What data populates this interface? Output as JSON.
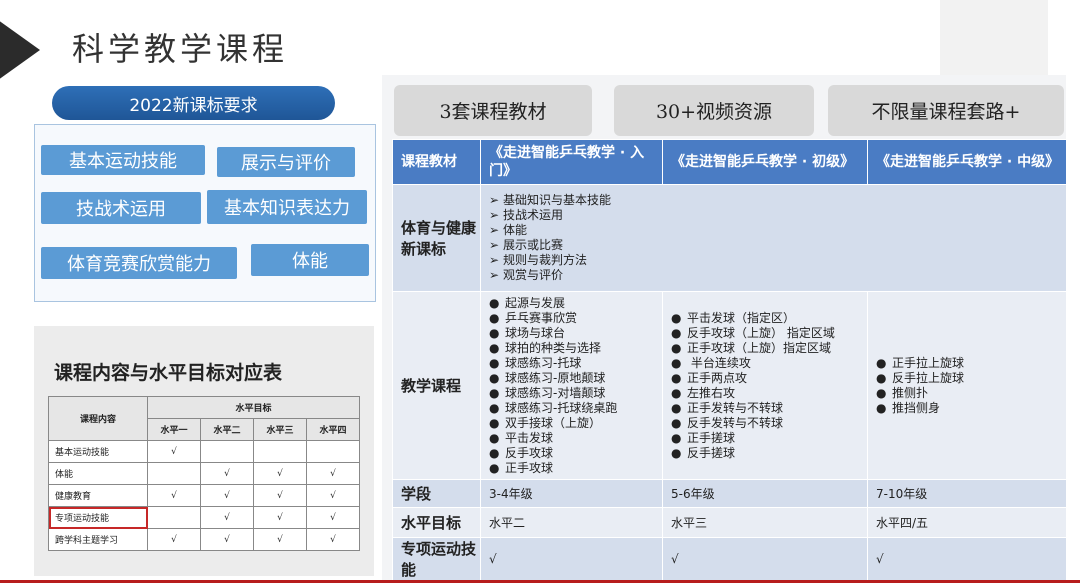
{
  "title": "科学教学课程",
  "requirements": {
    "pill": "2022新课标要求",
    "skills": [
      "基本运动技能",
      "展示与评价",
      "技战术运用",
      "基本知识表达力",
      "体育竞赛欣赏能力",
      "体能"
    ]
  },
  "mapping": {
    "title": "课程内容与水平目标对应表",
    "header_content": "课程内容",
    "header_goal": "水平目标",
    "levels": [
      "水平一",
      "水平二",
      "水平三",
      "水平四"
    ],
    "rows": [
      {
        "label": "基本运动技能",
        "marks": [
          "√",
          "",
          "",
          ""
        ]
      },
      {
        "label": "体能",
        "marks": [
          "",
          "√",
          "√",
          "√"
        ]
      },
      {
        "label": "健康教育",
        "marks": [
          "√",
          "√",
          "√",
          "√"
        ]
      },
      {
        "label": "专项运动技能",
        "marks": [
          "",
          "√",
          "√",
          "√"
        ]
      },
      {
        "label": "跨学科主题学习",
        "marks": [
          "√",
          "√",
          "√",
          "√"
        ]
      }
    ]
  },
  "resources": [
    "3套课程教材",
    "30+视频资源",
    "不限量课程套路+"
  ],
  "table": {
    "headers": [
      "课程教材",
      "《走进智能乒乓教学 · 入门》",
      "《走进智能乒乓教学 · 初级》",
      "《走进智能乒乓教学 · 中级》"
    ],
    "standard_label": "体育与健康新课标",
    "standard_items": [
      "基础知识与基本技能",
      "技战术运用",
      "体能",
      "展示或比赛",
      "规则与裁判方法",
      "观赏与评价"
    ],
    "course_label": "教学课程",
    "course_col1": [
      "起源与发展",
      "乒乓赛事欣赏",
      "球场与球台",
      "球拍的种类与选择",
      "球感练习-托球",
      "球感练习-原地颠球",
      "球感练习-对墙颠球",
      "球感练习-托球绕桌跑",
      "双手接球（上旋）",
      "平击发球",
      "反手攻球",
      "正手攻球"
    ],
    "course_col2": [
      "平击发球（指定区）",
      "反手攻球（上旋） 指定区域",
      "正手攻球（上旋）指定区域",
      " 半台连续攻",
      "正手两点攻",
      "左推右攻",
      "正手发转与不转球",
      "反手发转与不转球",
      "正手搓球",
      "反手搓球"
    ],
    "course_col3": [
      "正手拉上旋球",
      "反手拉上旋球",
      "推侧扑",
      "推挡侧身"
    ],
    "grade_label": "学段",
    "grades": [
      "3-4年级",
      "5-6年级",
      "7-10年级"
    ],
    "level_label": "水平目标",
    "levels": [
      "水平二",
      "水平三",
      "水平四/五"
    ],
    "special_label": "专项运动技能",
    "special": [
      "√",
      "√",
      "√"
    ]
  }
}
